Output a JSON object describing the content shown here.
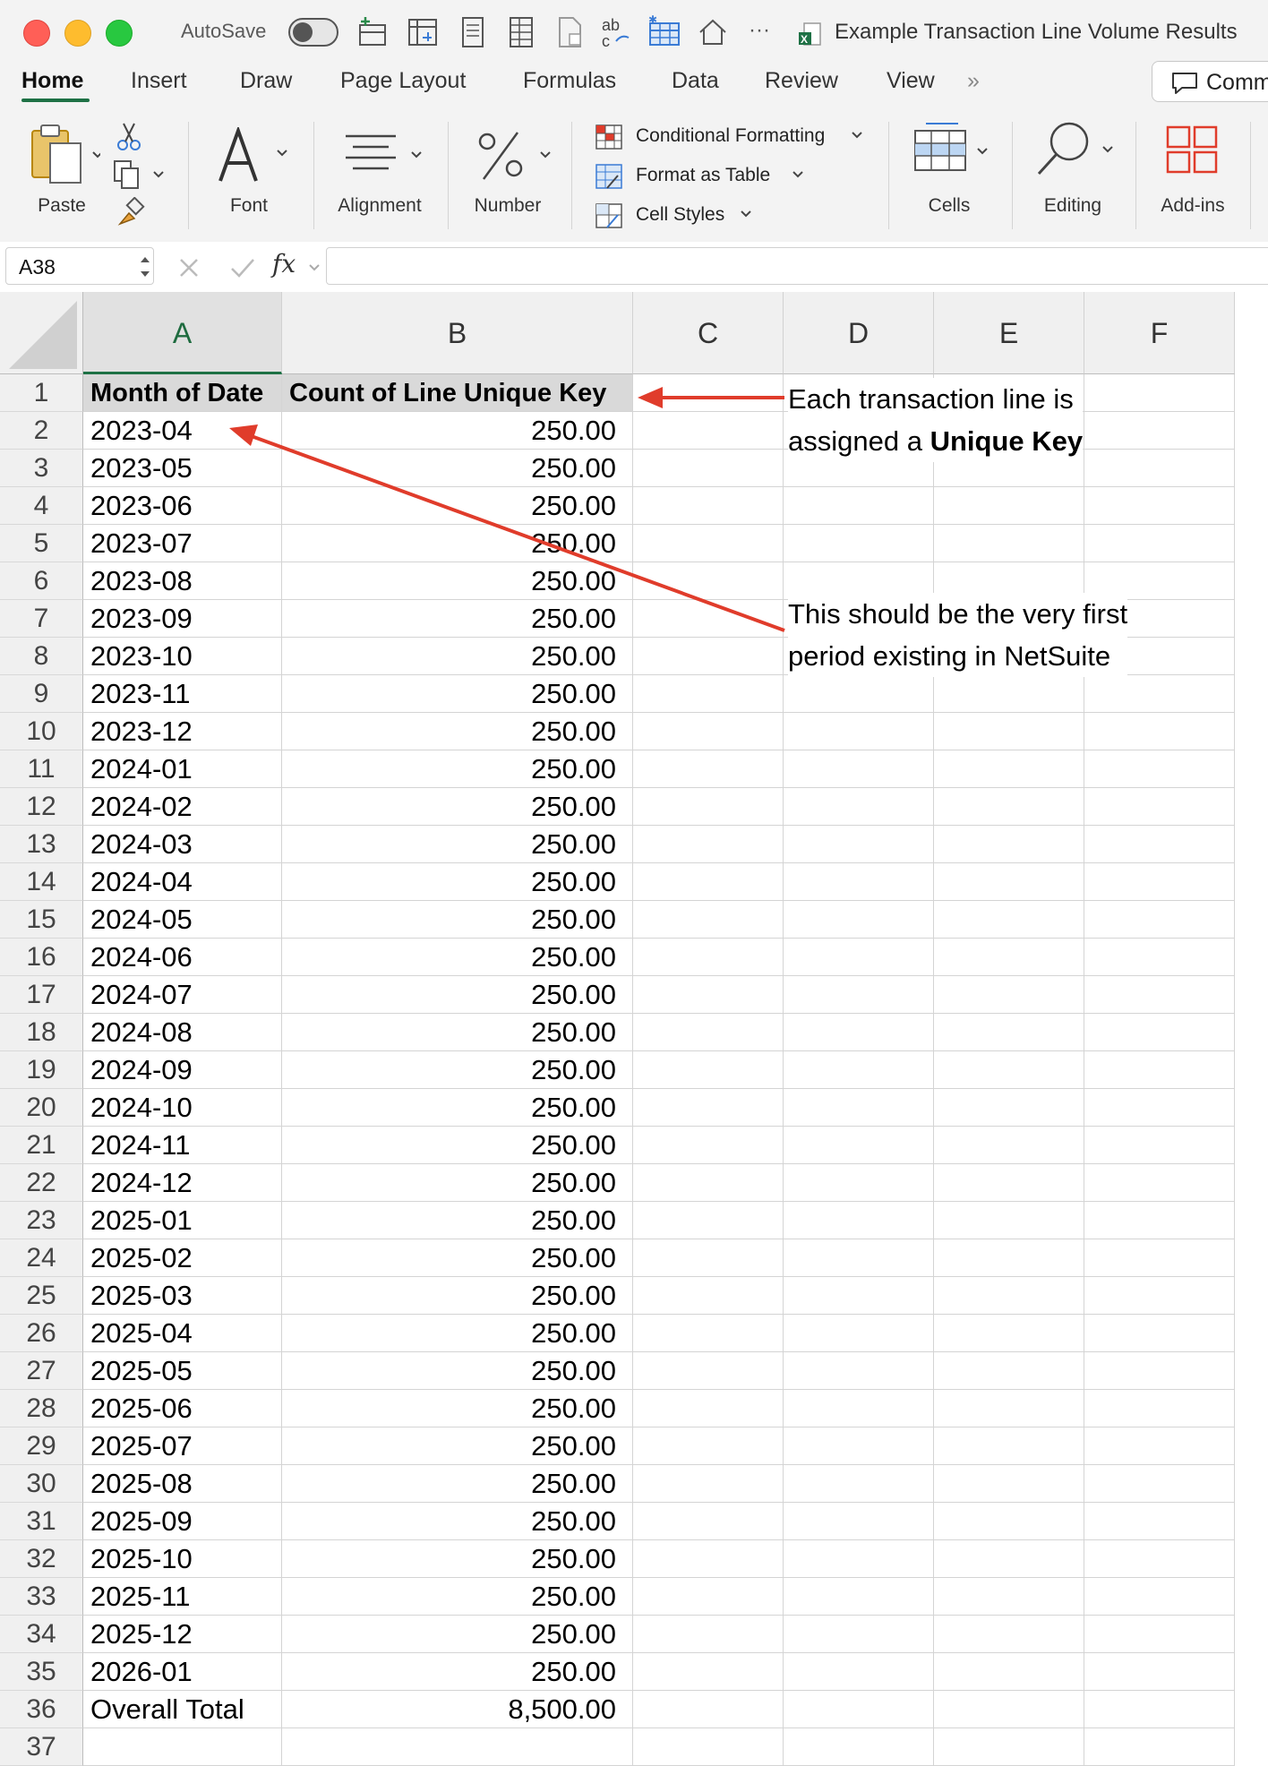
{
  "titlebar": {
    "autosave_label": "AutoSave",
    "qat_more": "···",
    "document_title": "Example Transaction Line Volume Results"
  },
  "ribbon_tabs": [
    "Home",
    "Insert",
    "Draw",
    "Page Layout",
    "Formulas",
    "Data",
    "Review",
    "View"
  ],
  "ribbon_overflow": "»",
  "comments_label": "Comm",
  "ribbon": {
    "paste": "Paste",
    "font": "Font",
    "alignment": "Alignment",
    "number": "Number",
    "conditional_formatting": "Conditional Formatting",
    "format_as_table": "Format as Table",
    "cell_styles": "Cell Styles",
    "cells": "Cells",
    "editing": "Editing",
    "addins": "Add-ins"
  },
  "formula_bar": {
    "name_box": "A38",
    "fx": "fx",
    "content": ""
  },
  "columns": [
    "A",
    "B",
    "C",
    "D",
    "E",
    "F"
  ],
  "sheet": {
    "header_a": "Month of Date",
    "header_b": "Count of Line Unique Key",
    "rows": [
      [
        "2023-04",
        "250.00"
      ],
      [
        "2023-05",
        "250.00"
      ],
      [
        "2023-06",
        "250.00"
      ],
      [
        "2023-07",
        "250.00"
      ],
      [
        "2023-08",
        "250.00"
      ],
      [
        "2023-09",
        "250.00"
      ],
      [
        "2023-10",
        "250.00"
      ],
      [
        "2023-11",
        "250.00"
      ],
      [
        "2023-12",
        "250.00"
      ],
      [
        "2024-01",
        "250.00"
      ],
      [
        "2024-02",
        "250.00"
      ],
      [
        "2024-03",
        "250.00"
      ],
      [
        "2024-04",
        "250.00"
      ],
      [
        "2024-05",
        "250.00"
      ],
      [
        "2024-06",
        "250.00"
      ],
      [
        "2024-07",
        "250.00"
      ],
      [
        "2024-08",
        "250.00"
      ],
      [
        "2024-09",
        "250.00"
      ],
      [
        "2024-10",
        "250.00"
      ],
      [
        "2024-11",
        "250.00"
      ],
      [
        "2024-12",
        "250.00"
      ],
      [
        "2025-01",
        "250.00"
      ],
      [
        "2025-02",
        "250.00"
      ],
      [
        "2025-03",
        "250.00"
      ],
      [
        "2025-04",
        "250.00"
      ],
      [
        "2025-05",
        "250.00"
      ],
      [
        "2025-06",
        "250.00"
      ],
      [
        "2025-07",
        "250.00"
      ],
      [
        "2025-08",
        "250.00"
      ],
      [
        "2025-09",
        "250.00"
      ],
      [
        "2025-10",
        "250.00"
      ],
      [
        "2025-11",
        "250.00"
      ],
      [
        "2025-12",
        "250.00"
      ],
      [
        "2026-01",
        "250.00"
      ]
    ],
    "total_label": "Overall Total",
    "total_value": "8,500.00",
    "extra_row_number": "37"
  },
  "annotations": {
    "note1_line1": "Each transaction line is",
    "note1_line2_prefix": "assigned a ",
    "note1_line2_bold": "Unique Key",
    "note2_line1": "This should be the very first",
    "note2_line2": "period existing in NetSuite"
  },
  "colors": {
    "excel_green": "#1e7145",
    "arrow_red": "#e03c2b",
    "traffic_close": "#ff5f57",
    "traffic_min": "#febc2e",
    "traffic_max": "#28c840"
  },
  "icons": [
    "toggle-switch",
    "new-sheet-icon",
    "pivot-icon",
    "page-icon",
    "sheet-icon",
    "doc-icon",
    "spelling-icon",
    "table-icon",
    "home-icon",
    "excel-file-icon",
    "comment-icon",
    "paste-icon",
    "cut-icon",
    "copy-icon",
    "format-painter-icon",
    "font-icon",
    "alignment-icon",
    "percent-icon",
    "conditional-formatting-icon",
    "format-table-icon",
    "cell-styles-icon",
    "cells-icon",
    "search-icon",
    "addins-icon",
    "cancel-icon",
    "confirm-icon"
  ]
}
